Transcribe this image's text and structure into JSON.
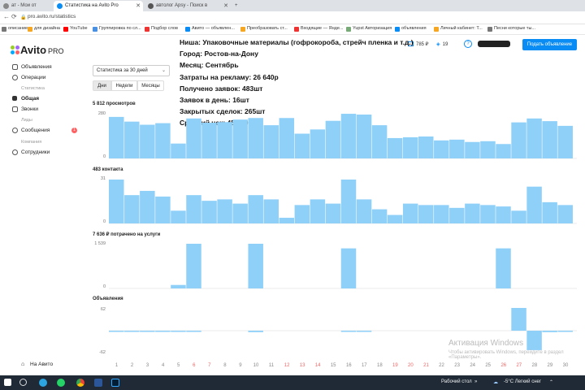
{
  "browser": {
    "tabs": [
      {
        "title": "ат - Мои от",
        "active": false,
        "color": "#888"
      },
      {
        "title": "Статистика на Avito Pro",
        "active": true,
        "color": "#0a8cf5"
      },
      {
        "title": "автолог Apsy - Поиск в",
        "active": false,
        "color": "#555"
      }
    ],
    "url": "pro.avito.ru/statistics",
    "bookmarks": [
      {
        "label": "описание",
        "color": "#777"
      },
      {
        "label": "для дизайна",
        "color": "#f5a623"
      },
      {
        "label": "YouTube",
        "color": "#f00"
      },
      {
        "label": "Группировка по сл...",
        "color": "#4a90e2"
      },
      {
        "label": "Подбор слов",
        "color": "#e33"
      },
      {
        "label": "Авито — объявлен...",
        "color": "#0a8cf5"
      },
      {
        "label": "Преобразовать ст...",
        "color": "#f5a623"
      },
      {
        "label": "Входящие — Янде...",
        "color": "#e33"
      },
      {
        "label": "Yupst Авторизация",
        "color": "#7a7"
      },
      {
        "label": "объявления",
        "color": "#0a8cf5"
      },
      {
        "label": "Личный кабинет: Т...",
        "color": "#f5a623"
      },
      {
        "label": "Песни которые ты...",
        "color": "#777"
      }
    ]
  },
  "sidebar": {
    "logo": "Avito",
    "logo_suffix": "PRO",
    "items": [
      {
        "label": "Объявления",
        "bold": false
      },
      {
        "label": "Операции",
        "bold": false
      }
    ],
    "group_stats": "Статистика",
    "stats_items": [
      {
        "label": "Общая",
        "bold": true
      },
      {
        "label": "Звонки",
        "bold": false
      }
    ],
    "group_leads": "Лиды",
    "leads_items": [
      {
        "label": "Сообщения",
        "badge": "1"
      }
    ],
    "group_company": "Компания",
    "company_items": [
      {
        "label": "Сотрудники"
      }
    ],
    "back_link": "На Авито"
  },
  "header": {
    "balance": "785 ₽",
    "bonus": "19",
    "help": "?",
    "create_button": "Подать объявление"
  },
  "overlay_lines": [
    "Ниша: Упаковочные материалы (гофрокороба, стрейч пленка и т.д.)",
    "Город: Ростов-на-Дону",
    "Месяц: Сентябрь",
    "Затраты на рекламу: 26 640р",
    "Получено заявок: 483шт",
    "Заявок в день: 16шт",
    "Закрытых сделок: 265шт",
    "Средний чек: 45 000р"
  ],
  "controls": {
    "period_select": "Статистика за 30 дней",
    "segments": [
      "Дни",
      "Недели",
      "Месяцы"
    ],
    "active_segment": 0
  },
  "chart_data": [
    {
      "type": "bar",
      "title": "5 812 просмотров",
      "x": [
        1,
        2,
        3,
        4,
        5,
        6,
        7,
        8,
        9,
        10,
        11,
        12,
        13,
        14,
        15,
        16,
        17,
        18,
        19,
        20,
        21,
        22,
        23,
        24,
        25,
        26,
        27,
        28,
        29,
        30
      ],
      "values": [
        265,
        235,
        215,
        225,
        95,
        255,
        228,
        232,
        248,
        258,
        212,
        258,
        158,
        185,
        240,
        285,
        280,
        212,
        130,
        135,
        140,
        115,
        120,
        105,
        110,
        92,
        230,
        255,
        238,
        208
      ],
      "yticks": [
        "280",
        "0"
      ],
      "ylim": [
        0,
        280
      ],
      "color": "#8fd0f9"
    },
    {
      "type": "bar",
      "title": "483 контакта",
      "x": [
        1,
        2,
        3,
        4,
        5,
        6,
        7,
        8,
        9,
        10,
        11,
        12,
        13,
        14,
        15,
        16,
        17,
        18,
        19,
        20,
        21,
        22,
        23,
        24,
        25,
        26,
        27,
        28,
        29,
        30
      ],
      "values": [
        31,
        20,
        23,
        19,
        9,
        20,
        16,
        17,
        14,
        20,
        17,
        4,
        13,
        17,
        14,
        31,
        17,
        10,
        6,
        14,
        13,
        13,
        11,
        14,
        13,
        12,
        9,
        26,
        15,
        13
      ],
      "yticks": [
        "31",
        "0"
      ],
      "ylim": [
        0,
        31
      ],
      "color": "#8fd0f9"
    },
    {
      "type": "bar",
      "title": "7 636 ₽ потрачено на услуги",
      "x": [
        1,
        2,
        3,
        4,
        5,
        6,
        7,
        8,
        9,
        10,
        11,
        12,
        13,
        14,
        15,
        16,
        17,
        18,
        19,
        20,
        21,
        22,
        23,
        24,
        25,
        26,
        27,
        28,
        29,
        30
      ],
      "values": [
        0,
        0,
        0,
        0,
        120,
        1539,
        0,
        0,
        0,
        1539,
        0,
        0,
        0,
        0,
        0,
        1380,
        0,
        0,
        0,
        0,
        0,
        0,
        0,
        0,
        0,
        1380,
        0,
        0,
        0,
        0
      ],
      "yticks": [
        "1 539",
        "0"
      ],
      "ylim": [
        0,
        1539
      ],
      "color": "#8fd0f9"
    },
    {
      "type": "bar",
      "title": "Объявления",
      "x": [
        1,
        2,
        3,
        4,
        5,
        6,
        7,
        8,
        9,
        10,
        11,
        12,
        13,
        14,
        15,
        16,
        17,
        18,
        19,
        20,
        21,
        22,
        23,
        24,
        25,
        26,
        27,
        28,
        29,
        30
      ],
      "values": [
        -2,
        -2,
        -2,
        -1,
        -1,
        -1,
        0,
        0,
        0,
        -4,
        0,
        0,
        0,
        0,
        0,
        -1,
        -2,
        0,
        0,
        0,
        0,
        0,
        0,
        0,
        0,
        0,
        62,
        -53,
        -4,
        -3
      ],
      "yticks": [
        "62",
        "-62"
      ],
      "ylim": [
        -62,
        62
      ],
      "color": "#8fd0f9"
    }
  ],
  "x_labels": [
    "1",
    "2",
    "3",
    "4",
    "5",
    "6",
    "7",
    "8",
    "9",
    "10",
    "11",
    "12",
    "13",
    "14",
    "15",
    "16",
    "17",
    "18",
    "19",
    "20",
    "21",
    "22",
    "23",
    "24",
    "25",
    "26",
    "27",
    "28",
    "29",
    "30"
  ],
  "weekend_days": [
    6,
    7,
    12,
    13,
    14,
    19,
    20,
    21,
    26,
    27
  ],
  "watermark": {
    "title": "Активация Windows",
    "subtitle": "Чтобы активировать Windows, перейдите в раздел «Параметры»."
  },
  "taskbar": {
    "desktop_label": "Рабочий стол",
    "weather": "-5°C  Легкий снег",
    "lang": "РУС",
    "icons": [
      "start-icon",
      "search-icon",
      "telegram-icon",
      "whatsapp-icon",
      "chrome-icon",
      "word-icon",
      "excel-icon",
      "photoshop-icon"
    ]
  }
}
